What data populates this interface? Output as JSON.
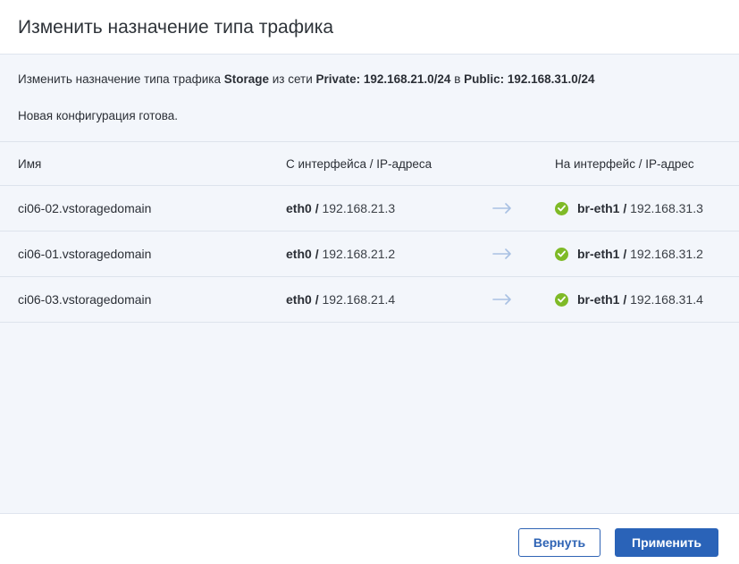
{
  "dialog": {
    "title": "Изменить назначение типа трафика"
  },
  "intro": {
    "prefix": "Изменить назначение типа трафика",
    "traffic_type": "Storage",
    "from_network_label": "из сети",
    "from_network": "Private: 192.168.21.0/24",
    "to_label": "в",
    "to_network": "Public: 192.168.31.0/24"
  },
  "status": "Новая конфигурация готова.",
  "table": {
    "columns": {
      "name": "Имя",
      "from": "С интерфейса / IP-адреса",
      "to": "На интерфейс / IP-адрес"
    },
    "rows": [
      {
        "name": "ci06-02.vstoragedomain",
        "from_iface": "eth0",
        "from_ip": "192.168.21.3",
        "to_iface": "br-eth1",
        "to_ip": "192.168.31.3"
      },
      {
        "name": "ci06-01.vstoragedomain",
        "from_iface": "eth0",
        "from_ip": "192.168.21.2",
        "to_iface": "br-eth1",
        "to_ip": "192.168.31.2"
      },
      {
        "name": "ci06-03.vstoragedomain",
        "from_iface": "eth0",
        "from_ip": "192.168.21.4",
        "to_iface": "br-eth1",
        "to_ip": "192.168.31.4"
      }
    ],
    "separator": "/"
  },
  "buttons": {
    "revert": "Вернуть",
    "apply": "Применить"
  },
  "icons": {
    "arrow": "arrow-right-icon",
    "status": "check-circle-icon"
  },
  "colors": {
    "primary": "#2a63b8",
    "success": "#7fba27",
    "arrow": "#a9c1e3",
    "background": "#f3f6fb"
  }
}
